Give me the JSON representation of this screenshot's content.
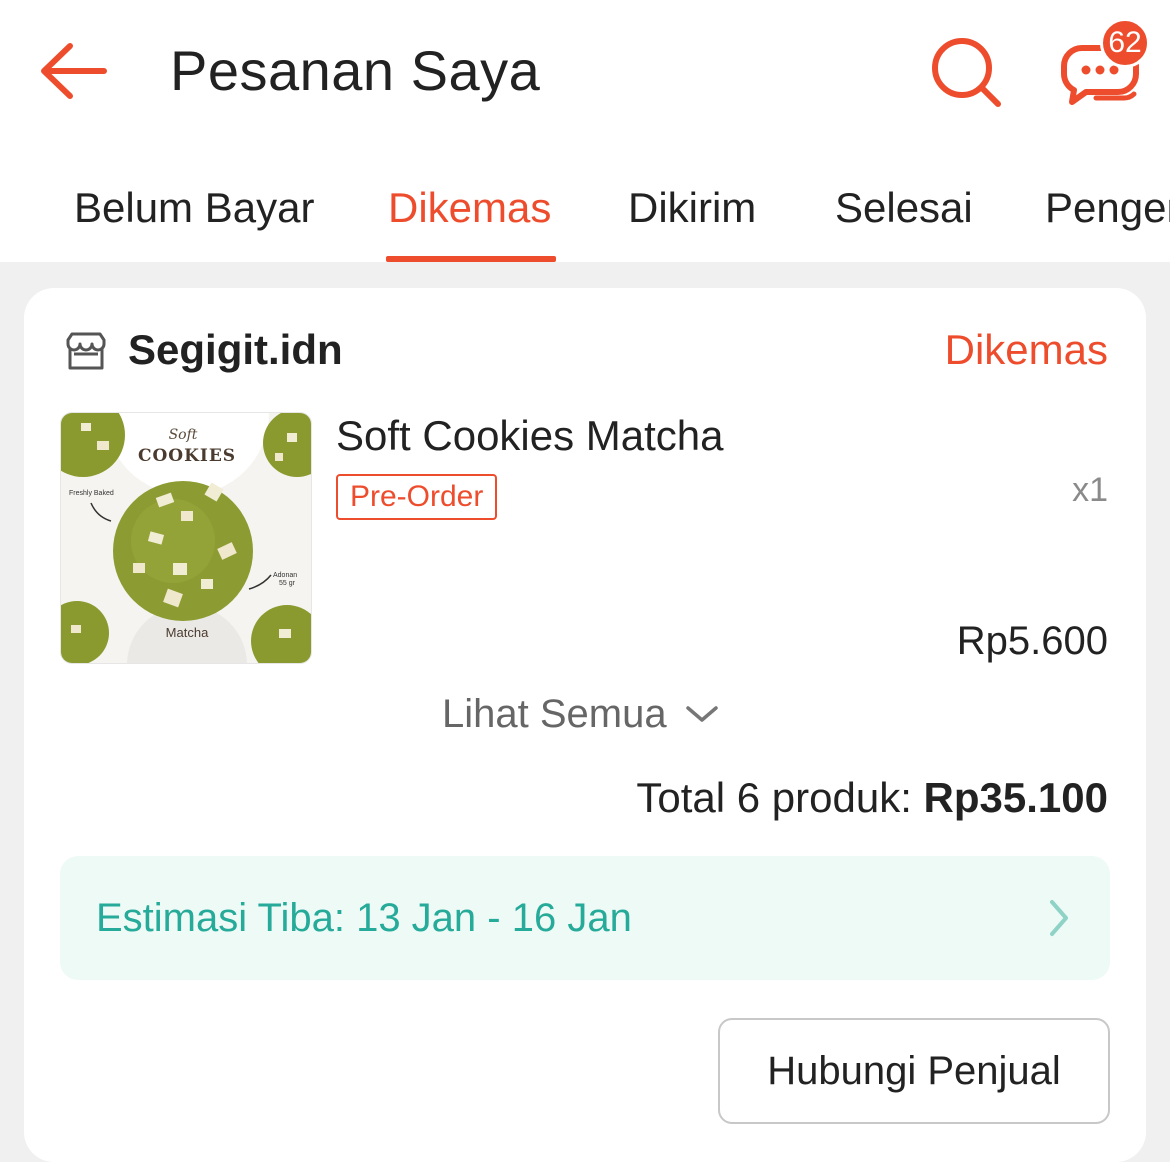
{
  "header": {
    "title": "Pesanan Saya",
    "chat_badge_count": "62",
    "accent_color": "#ee4d2d",
    "icons": [
      "back-arrow-icon",
      "search-icon",
      "chat-icon"
    ]
  },
  "tabs": [
    {
      "label": "Belum Bayar",
      "active": false
    },
    {
      "label": "Dikemas",
      "active": true
    },
    {
      "label": "Dikirim",
      "active": false
    },
    {
      "label": "Selesai",
      "active": false
    },
    {
      "label": "Pengem",
      "active": false
    }
  ],
  "order": {
    "shop_name": "Segigit.idn",
    "status": "Dikemas",
    "product": {
      "name": "Soft Cookies Matcha",
      "badge": "Pre-Order",
      "quantity": "x1",
      "price": "Rp5.600",
      "image_text": {
        "script": "Soft",
        "title": "COOKIES",
        "left_note": "Freshly Baked",
        "right_note_line1": "Adonan",
        "right_note_line2": "55 gr",
        "flavor": "Matcha"
      }
    },
    "see_all_label": "Lihat Semua",
    "total_label": "Total 6 produk:",
    "total_amount": "Rp35.100",
    "eta_text": "Estimasi Tiba: 13 Jan - 16 Jan",
    "eta_color": "#26aa99",
    "contact_button": "Hubungi Penjual"
  }
}
